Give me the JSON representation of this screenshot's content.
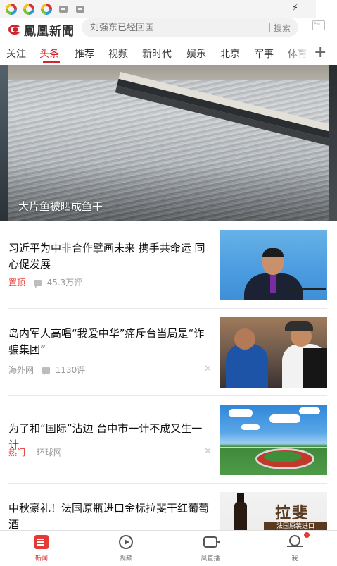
{
  "colors": {
    "brand_red": "#d0262b",
    "tag_red": "#e53935",
    "meta_gray": "#999999",
    "divider": "#e8e8e8"
  },
  "header": {
    "logo_text": "鳳凰新聞",
    "search": {
      "placeholder": "刘强东已经回国",
      "button_label": "搜索"
    },
    "right_icon": "pm-weather-icon"
  },
  "tabs": [
    {
      "label": "关注"
    },
    {
      "label": "头条",
      "active": true
    },
    {
      "label": "推荐"
    },
    {
      "label": "视频"
    },
    {
      "label": "新时代"
    },
    {
      "label": "娱乐"
    },
    {
      "label": "北京"
    },
    {
      "label": "军事"
    },
    {
      "label": "体育"
    }
  ],
  "tab_more_label": "+",
  "hero": {
    "caption": "大片鱼被晒成鱼干"
  },
  "news": [
    {
      "title": "习近平为中非合作擘画未来 携手共命运 同心促发展",
      "tag": "置顶",
      "source": "",
      "comments": "45.3万评",
      "closable": false
    },
    {
      "title": "岛内军人高唱“我爱中华”痛斥台当局是“诈骗集团”",
      "tag": "",
      "source": "海外网",
      "comments": "1130评",
      "closable": true
    },
    {
      "title": "为了和“国际”沾边 台中市一计不成又生一计",
      "tag": "热门",
      "source": "环球网",
      "comments": "",
      "closable": true
    },
    {
      "title": "中秋豪礼！法国原瓶进口金标拉斐干红葡萄酒",
      "tag": "",
      "source": "",
      "comments": "",
      "closable": false,
      "thumb_text": {
        "word": "拉斐",
        "banner": "法国原装进口"
      }
    }
  ],
  "bottom_nav": [
    {
      "label": "新闻",
      "icon": "news-icon",
      "active": true
    },
    {
      "label": "视频",
      "icon": "play-icon"
    },
    {
      "label": "凤直播",
      "icon": "live-camera-icon"
    },
    {
      "label": "我",
      "icon": "profile-icon",
      "badge": true
    }
  ]
}
